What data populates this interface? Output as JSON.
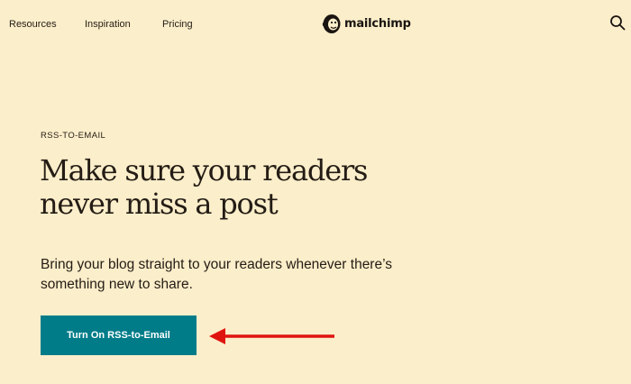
{
  "nav": {
    "links": [
      {
        "label": "Resources"
      },
      {
        "label": "Inspiration"
      },
      {
        "label": "Pricing"
      }
    ],
    "logo_text": "mailchimp",
    "search_icon": "search-icon"
  },
  "hero": {
    "eyebrow": "RSS-TO-EMAIL",
    "headline_lines": [
      "Make sure your readers",
      "never miss a post"
    ],
    "subtext_lines": [
      "Bring your blog straight to your readers whenever there’s",
      "something new to share."
    ],
    "cta_label": "Turn On RSS-to-Email"
  },
  "annotation": {
    "icon": "red-arrow-left",
    "color": "#E0140E"
  },
  "colors": {
    "background": "#FBEECA",
    "text": "#241C15",
    "button": "#007C89",
    "button_text": "#FFFFFF"
  }
}
